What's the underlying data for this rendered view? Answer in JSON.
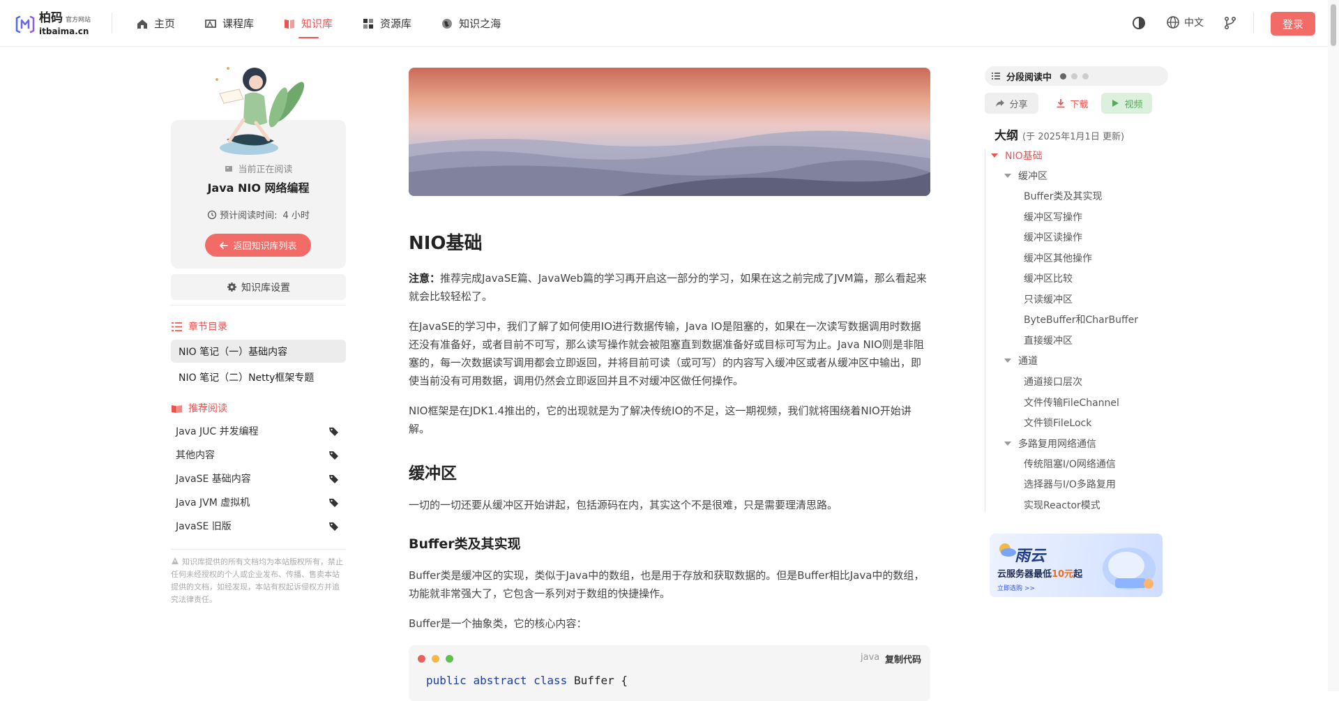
{
  "brand": {
    "name": "柏码",
    "official": "官方网站",
    "domain": "itbaima.cn"
  },
  "nav": [
    {
      "label": "主页",
      "icon": "home-icon",
      "active": false
    },
    {
      "label": "课程库",
      "icon": "course-icon",
      "active": false
    },
    {
      "label": "知识库",
      "icon": "book-icon",
      "active": true
    },
    {
      "label": "资源库",
      "icon": "grid-icon",
      "active": false
    },
    {
      "label": "知识之海",
      "icon": "globe-icon",
      "active": false
    }
  ],
  "topbar": {
    "language": "中文",
    "login": "登录"
  },
  "reading": {
    "label": "当前正在阅读",
    "title": "Java NIO 网络编程",
    "time_label": "预计阅读时间:",
    "time_value": "4 小时",
    "back": "返回知识库列表",
    "settings": "知识库设置"
  },
  "chapters": {
    "title": "章节目录",
    "items": [
      "NIO 笔记（一）基础内容",
      "NIO 笔记（二）Netty框架专题"
    ]
  },
  "recommend": {
    "title": "推荐阅读",
    "items": [
      "Java JUC 并发编程",
      "其他内容",
      "JavaSE 基础内容",
      "Java JVM 虚拟机",
      "JavaSE 旧版"
    ]
  },
  "disclaimer": "知识库提供的所有文档均为本站版权所有，禁止任何未经授权的个人或企业发布、传播、售卖本站提供的文档，如经发现，本站有权起诉侵权方并追究法律责任。",
  "article": {
    "h1": "NIO基础",
    "note_label": "注意：",
    "note_text": "推荐完成JavaSE篇、JavaWeb篇的学习再开启这一部分的学习，如果在这之前完成了JVM篇，那么看起来就会比较轻松了。",
    "p1": "在JavaSE的学习中，我们了解了如何使用IO进行数据传输，Java IO是阻塞的，如果在一次读写数据调用时数据还没有准备好，或者目前不可写，那么读写操作就会被阻塞直到数据准备好或目标可写为止。Java NIO则是非阻塞的，每一次数据读写调用都会立即返回，并将目前可读（或可写）的内容写入缓冲区或者从缓冲区中输出，即使当前没有可用数据，调用仍然会立即返回并且不对缓冲区做任何操作。",
    "p2": "NIO框架是在JDK1.4推出的，它的出现就是为了解决传统IO的不足，这一期视频，我们就将围绕着NIO开始讲解。",
    "h2": "缓冲区",
    "p3": "一切的一切还要从缓冲区开始讲起，包括源码在内，其实这个不是很难，只是需要理清思路。",
    "h3": "Buffer类及其实现",
    "p4": "Buffer类是缓冲区的实现，类似于Java中的数组，也是用于存放和获取数据的。但是Buffer相比Java中的数组，功能就非常强大了，它包含一系列对于数组的快捷操作。",
    "p5": "Buffer是一个抽象类，它的核心内容：",
    "code": {
      "lang": "java",
      "copy": "复制代码",
      "kw1": "public",
      "kw2": "abstract",
      "kw3": "class",
      "rest": " Buffer {"
    }
  },
  "right": {
    "segment": "分段阅读中",
    "share": "分享",
    "download": "下载",
    "video": "视频",
    "outline_title": "大纲",
    "outline_updated": "(于 2025年1月1日 更新)",
    "outline": [
      {
        "label": "NIO基础",
        "level": 0,
        "expand": true
      },
      {
        "label": "缓冲区",
        "level": 1,
        "expand": true
      },
      {
        "label": "Buffer类及其实现",
        "level": 2
      },
      {
        "label": "缓冲区写操作",
        "level": 2
      },
      {
        "label": "缓冲区读操作",
        "level": 2
      },
      {
        "label": "缓冲区其他操作",
        "level": 2
      },
      {
        "label": "缓冲区比较",
        "level": 2
      },
      {
        "label": "只读缓冲区",
        "level": 2
      },
      {
        "label": "ByteBuffer和CharBuffer",
        "level": 2
      },
      {
        "label": "直接缓冲区",
        "level": 2
      },
      {
        "label": "通道",
        "level": 1,
        "expand": true
      },
      {
        "label": "通道接口层次",
        "level": 2
      },
      {
        "label": "文件传输FileChannel",
        "level": 2
      },
      {
        "label": "文件锁FileLock",
        "level": 2
      },
      {
        "label": "多路复用网络通信",
        "level": 1,
        "expand": true
      },
      {
        "label": "传统阻塞I/O网络通信",
        "level": 2
      },
      {
        "label": "选择器与I/O多路复用",
        "level": 2
      },
      {
        "label": "实现Reactor模式",
        "level": 2
      }
    ],
    "ad": {
      "brand": "雨云",
      "slogan_pre": "云服务器最低",
      "slogan_price": "10元",
      "slogan_post": "起",
      "cta": "立即选购 >>"
    }
  },
  "colors": {
    "accent": "#ef5350",
    "button": "#f26b67",
    "video_green": "#4caf50"
  }
}
